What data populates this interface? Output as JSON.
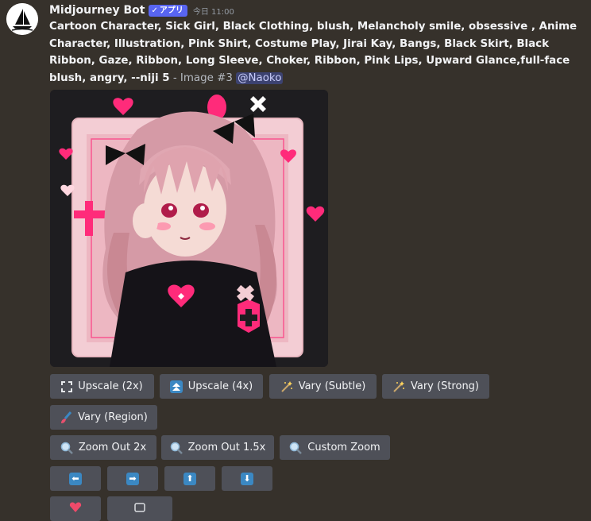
{
  "message": {
    "author": "Midjourney Bot",
    "badge": "アプリ",
    "badge_check": "✓",
    "timestamp": "今日 11:00",
    "prompt": "Cartoon Character, Sick Girl, Black Clothing, blush, Melancholy smile, obsessive , Anime Character, Illustration, Pink Shirt, Costume Play, Jirai Kay, Bangs, Black Skirt, Black Ribbon, Gaze, Ribbon, Long Sleeve, Choker, Ribbon, Pink Lips, Upward Glance,full-face blush, angry, --niji 5",
    "suffix": " - Image #3 ",
    "mention": "@Naoko"
  },
  "buttons": {
    "upscale_2x": "Upscale (2x)",
    "upscale_4x": "Upscale (4x)",
    "vary_subtle": "Vary (Subtle)",
    "vary_strong": "Vary (Strong)",
    "vary_region": "Vary (Region)",
    "zoom_out_2x": "Zoom Out 2x",
    "zoom_out_15x": "Zoom Out 1.5x",
    "custom_zoom": "Custom Zoom",
    "arrows": {
      "left": "⬅",
      "right": "➡",
      "up": "⬆",
      "down": "⬇"
    }
  },
  "icons": {
    "upscale_2x": "expand-arrows-icon",
    "upscale_4x": "double-up-arrow-icon",
    "vary_subtle": "sparkle-wand-icon",
    "vary_strong": "sparkle-wand-icon",
    "vary_region": "paintbrush-icon",
    "zoom": "magnifier-icon",
    "reroll": "heart-icon",
    "web": "link-icon"
  },
  "colors": {
    "background": "#36312b",
    "button": "#4e5058",
    "badge": "#5865f2",
    "arrow_blue": "#3b88c3",
    "mention_bg": "#3c4270",
    "accent_pink": "#ff2b7a"
  }
}
